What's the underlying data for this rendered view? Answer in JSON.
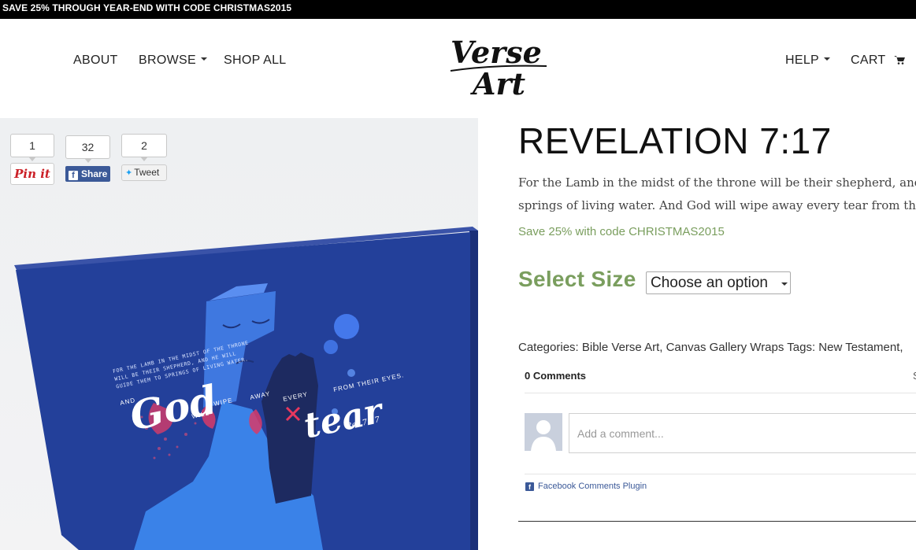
{
  "promo_bar": {
    "text": "SAVE 25% THROUGH YEAR-END WITH CODE ",
    "code": "CHRISTMAS2015"
  },
  "nav": {
    "about": "ABOUT",
    "browse": "BROWSE",
    "shop_all": "SHOP ALL",
    "help": "HELP",
    "cart": "CART",
    "logo_text": [
      "Verse",
      "Art"
    ]
  },
  "social": {
    "pinterest_count": "1",
    "pinterest_label": "Pin it",
    "facebook_count": "32",
    "facebook_label": "Share",
    "twitter_count": "2",
    "twitter_label": "Tweet"
  },
  "artwork": {
    "big_word_1": "God",
    "big_word_2": "tear",
    "small_words": [
      "WILL",
      "WIPE",
      "AWAY",
      "EVERY",
      "FROM THEIR EYES.",
      "Rev.7:17",
      "AND"
    ],
    "verse_lines": [
      "FOR THE LAMB IN THE MIDST OF THE THRONE",
      "WILL BE THEIR SHEPHERD, AND HE WILL",
      "GUIDE THEM TO SPRINGS OF LIVING WATER."
    ]
  },
  "product": {
    "title": "REVELATION 7:17",
    "description_line1": "For the Lamb in the midst of the throne will be their shepherd, and He will guide them to",
    "description_line2": "springs of living water. And God will wipe away every tear from their eyes.",
    "promo": "Save 25% with code CHRISTMAS2015",
    "select_label": "Select Size",
    "select_value": "Choose an option",
    "meta": "Categories: Bible Verse Art, Canvas Gallery Wraps Tags: New Testament,"
  },
  "comments": {
    "count_label": "0 Comments",
    "sort_label": "S",
    "placeholder": "Add a comment...",
    "plugin_label": "Facebook Comments Plugin"
  },
  "colors": {
    "accent_green": "#7a9e5e",
    "facebook_blue": "#3b5998",
    "pinterest_red": "#cb2027",
    "canvas_blue": "#23409a"
  }
}
